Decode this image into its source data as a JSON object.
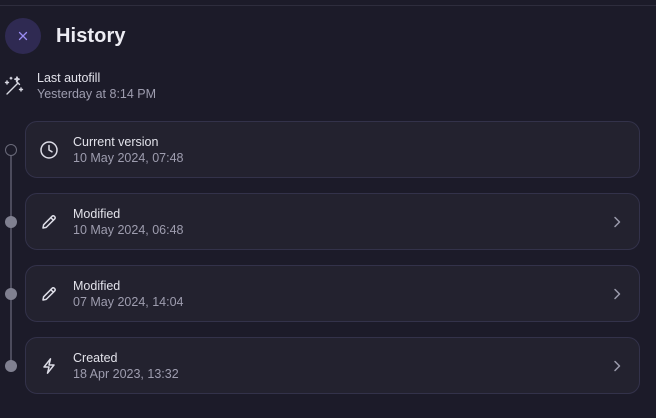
{
  "header": {
    "title": "History",
    "close_icon": "close-icon"
  },
  "autofill": {
    "icon": "magic-wand-icon",
    "label": "Last autofill",
    "time": "Yesterday at 8:14 PM"
  },
  "history": [
    {
      "icon": "clock-icon",
      "label": "Current version",
      "date": "10 May 2024, 07:48",
      "has_chevron": false,
      "dot": "hollow"
    },
    {
      "icon": "pencil-icon",
      "label": "Modified",
      "date": "10 May 2024, 06:48",
      "has_chevron": true,
      "dot": "filled"
    },
    {
      "icon": "pencil-icon",
      "label": "Modified",
      "date": "07 May 2024, 14:04",
      "has_chevron": true,
      "dot": "filled"
    },
    {
      "icon": "bolt-icon",
      "label": "Created",
      "date": "18 Apr 2023, 13:32",
      "has_chevron": true,
      "dot": "filled"
    }
  ],
  "colors": {
    "background": "#1c1b29",
    "card": "#23222f",
    "accent": "#2f2a52",
    "accent_icon": "#9a8cf2"
  }
}
